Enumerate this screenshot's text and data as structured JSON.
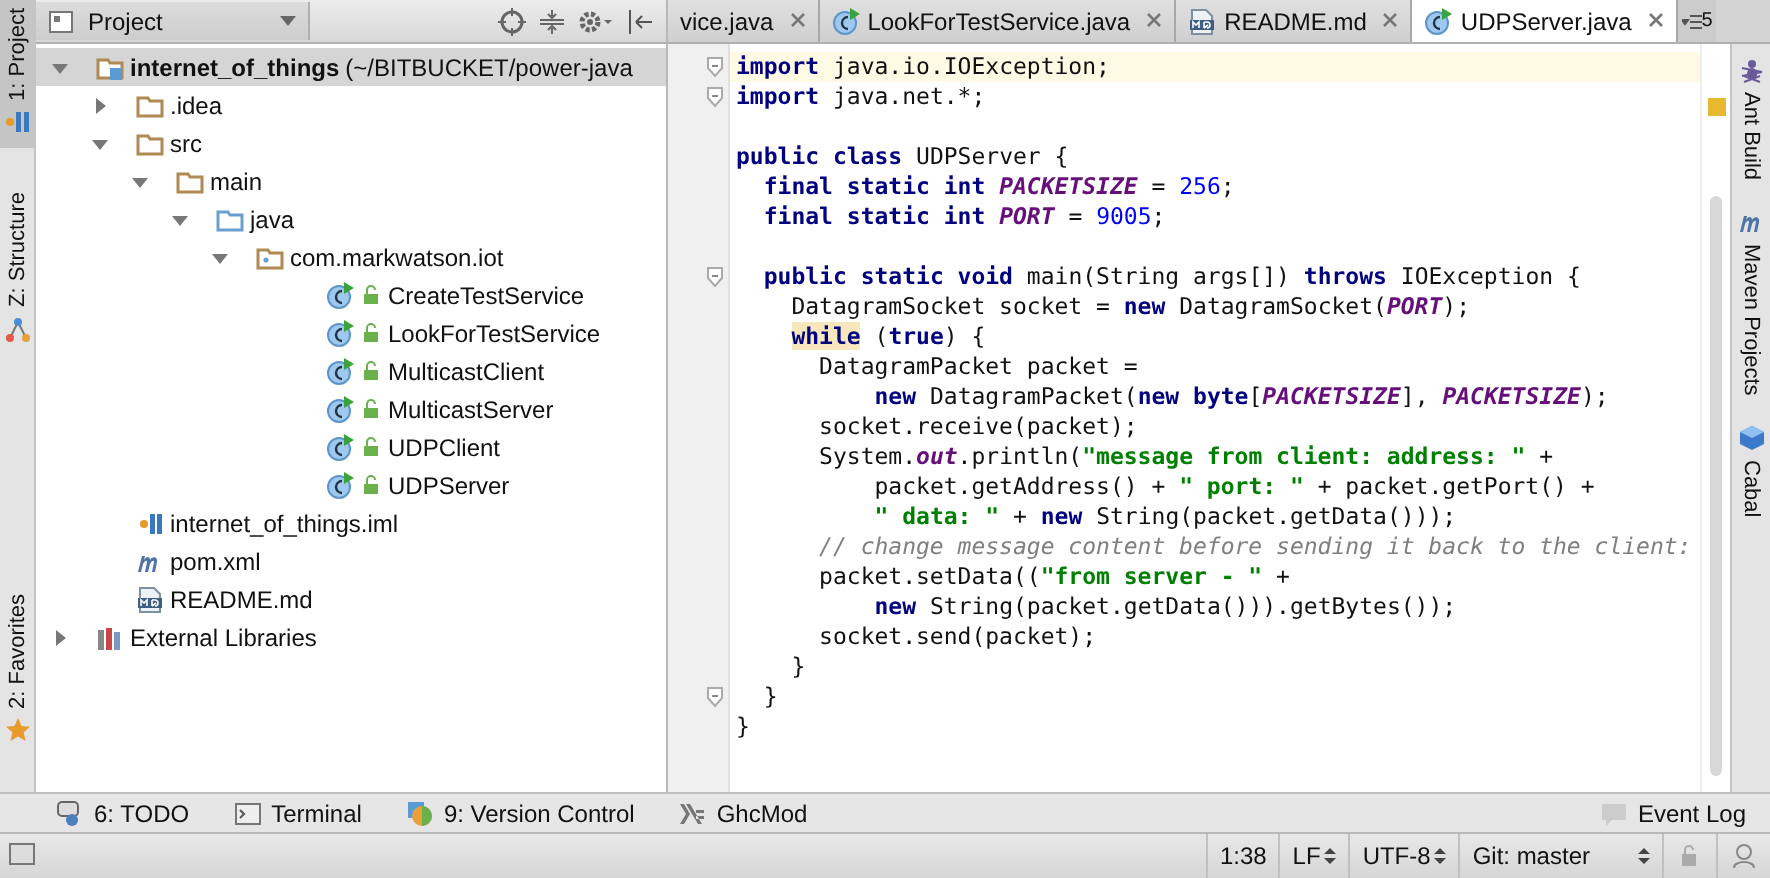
{
  "left_strip": [
    {
      "label": "1: Project",
      "kind": "project",
      "selected": true
    },
    {
      "label": "Z: Structure",
      "kind": "structure",
      "selected": false
    },
    {
      "label": "2: Favorites",
      "kind": "star",
      "selected": false
    }
  ],
  "project_panel": {
    "title": "Project"
  },
  "tree": [
    {
      "label": "internet_of_things",
      "suffix": "(~/BITBUCKET/power-java",
      "kind": "module",
      "expanded": true,
      "selected": true,
      "children": [
        {
          "label": ".idea",
          "kind": "folder",
          "expanded": false,
          "selected": false
        },
        {
          "label": "src",
          "kind": "folder",
          "expanded": true,
          "selected": false,
          "children": [
            {
              "label": "main",
              "kind": "folder",
              "expanded": true,
              "selected": false,
              "children": [
                {
                  "label": "java",
                  "kind": "source",
                  "expanded": true,
                  "selected": false,
                  "children": [
                    {
                      "label": "com.markwatson.iot",
                      "kind": "package",
                      "expanded": true,
                      "selected": false,
                      "children": [
                        {
                          "label": "CreateTestService",
                          "kind": "class",
                          "selected": false
                        },
                        {
                          "label": "LookForTestService",
                          "kind": "class",
                          "selected": false
                        },
                        {
                          "label": "MulticastClient",
                          "kind": "class",
                          "selected": false
                        },
                        {
                          "label": "MulticastServer",
                          "kind": "class",
                          "selected": false
                        },
                        {
                          "label": "UDPClient",
                          "kind": "class",
                          "selected": false
                        },
                        {
                          "label": "UDPServer",
                          "kind": "class",
                          "selected": false
                        }
                      ]
                    }
                  ]
                }
              ]
            }
          ]
        },
        {
          "label": "internet_of_things.iml",
          "kind": "iml",
          "selected": false
        },
        {
          "label": "pom.xml",
          "kind": "maven",
          "selected": false
        },
        {
          "label": "README.md",
          "kind": "md",
          "selected": false
        }
      ]
    },
    {
      "label": "External Libraries",
      "kind": "libraries",
      "expanded": false,
      "selected": false
    }
  ],
  "tabs": [
    {
      "label": "vice.java",
      "kind": "plain",
      "selected": false
    },
    {
      "label": "LookForTestService.java",
      "kind": "class",
      "selected": false
    },
    {
      "label": "README.md",
      "kind": "md",
      "selected": false
    },
    {
      "label": "UDPServer.java",
      "kind": "class",
      "selected": true
    }
  ],
  "tab_overflow": "5",
  "code_lines": [
    {
      "current": true,
      "fold": true,
      "tokens": [
        {
          "kind": "kw",
          "text": "import"
        },
        {
          "kind": "plain",
          "text": " java.io.IOException;"
        }
      ]
    },
    {
      "current": false,
      "fold": true,
      "tokens": [
        {
          "kind": "kw",
          "text": "import"
        },
        {
          "kind": "plain",
          "text": " java.net.*;"
        }
      ]
    },
    {
      "current": false,
      "fold": false
    },
    {
      "current": false,
      "fold": false,
      "tokens": [
        {
          "kind": "kw",
          "text": "public class"
        },
        {
          "kind": "plain",
          "text": " UDPServer {"
        }
      ]
    },
    {
      "current": false,
      "fold": false,
      "tokens": [
        {
          "kind": "kw",
          "text": "  final static int"
        },
        {
          "kind": "const",
          "text": " PACKETSIZE"
        },
        {
          "kind": "plain",
          "text": " = "
        },
        {
          "kind": "num",
          "text": "256"
        },
        {
          "kind": "plain",
          "text": ";"
        }
      ]
    },
    {
      "current": false,
      "fold": false,
      "tokens": [
        {
          "kind": "kw",
          "text": "  final static int"
        },
        {
          "kind": "const",
          "text": " PORT"
        },
        {
          "kind": "plain",
          "text": " = "
        },
        {
          "kind": "num",
          "text": "9005"
        },
        {
          "kind": "plain",
          "text": ";"
        }
      ]
    },
    {
      "current": false,
      "fold": false
    },
    {
      "current": false,
      "fold": true,
      "tokens": [
        {
          "kind": "kw",
          "text": "  public static void"
        },
        {
          "kind": "plain",
          "text": " main(String args[]) "
        },
        {
          "kind": "kw",
          "text": "throws"
        },
        {
          "kind": "plain",
          "text": " IOException {"
        }
      ]
    },
    {
      "current": false,
      "fold": false,
      "tokens": [
        {
          "kind": "plain",
          "text": "    DatagramSocket socket = "
        },
        {
          "kind": "kw",
          "text": "new"
        },
        {
          "kind": "plain",
          "text": " DatagramSocket("
        },
        {
          "kind": "const",
          "text": "PORT"
        },
        {
          "kind": "plain",
          "text": ");"
        }
      ]
    },
    {
      "current": false,
      "fold": false,
      "tokens": [
        {
          "kind": "kw-marked",
          "text": "    while"
        },
        {
          "kind": "plain",
          "text": " ("
        },
        {
          "kind": "kw",
          "text": "true"
        },
        {
          "kind": "plain",
          "text": ") {"
        }
      ]
    },
    {
      "current": false,
      "fold": false,
      "tokens": [
        {
          "kind": "plain",
          "text": "      DatagramPacket packet ="
        }
      ]
    },
    {
      "current": false,
      "fold": false,
      "tokens": [
        {
          "kind": "kw",
          "text": "          new"
        },
        {
          "kind": "plain",
          "text": " DatagramPacket("
        },
        {
          "kind": "kw",
          "text": "new byte"
        },
        {
          "kind": "plain",
          "text": "["
        },
        {
          "kind": "const",
          "text": "PACKETSIZE"
        },
        {
          "kind": "plain",
          "text": "], "
        },
        {
          "kind": "const",
          "text": "PACKETSIZE"
        },
        {
          "kind": "plain",
          "text": ");"
        }
      ]
    },
    {
      "current": false,
      "fold": false,
      "tokens": [
        {
          "kind": "plain",
          "text": "      socket.receive(packet);"
        }
      ]
    },
    {
      "current": false,
      "fold": false,
      "tokens": [
        {
          "kind": "plain",
          "text": "      System."
        },
        {
          "kind": "const",
          "text": "out"
        },
        {
          "kind": "plain",
          "text": ".println("
        },
        {
          "kind": "str",
          "text": "\"message from client: address: \""
        },
        {
          "kind": "plain",
          "text": " +"
        }
      ]
    },
    {
      "current": false,
      "fold": false,
      "tokens": [
        {
          "kind": "plain",
          "text": "          packet.getAddress() + "
        },
        {
          "kind": "str",
          "text": "\" port: \""
        },
        {
          "kind": "plain",
          "text": " + packet.getPort() +"
        }
      ]
    },
    {
      "current": false,
      "fold": false,
      "tokens": [
        {
          "kind": "str",
          "text": "          \" data: \""
        },
        {
          "kind": "plain",
          "text": " + "
        },
        {
          "kind": "kw",
          "text": "new"
        },
        {
          "kind": "plain",
          "text": " String(packet.getData()));"
        }
      ]
    },
    {
      "current": false,
      "fold": false,
      "tokens": [
        {
          "kind": "comment",
          "text": "      // change message content before sending it back to the client:"
        }
      ]
    },
    {
      "current": false,
      "fold": false,
      "tokens": [
        {
          "kind": "plain",
          "text": "      packet.setData(("
        },
        {
          "kind": "str",
          "text": "\"from server - \""
        },
        {
          "kind": "plain",
          "text": " +"
        }
      ]
    },
    {
      "current": false,
      "fold": false,
      "tokens": [
        {
          "kind": "kw",
          "text": "          new"
        },
        {
          "kind": "plain",
          "text": " String(packet.getData())).getBytes());"
        }
      ]
    },
    {
      "current": false,
      "fold": false,
      "tokens": [
        {
          "kind": "plain",
          "text": "      socket.send(packet);"
        }
      ]
    },
    {
      "current": false,
      "fold": false,
      "tokens": [
        {
          "kind": "plain",
          "text": "    }"
        }
      ]
    },
    {
      "current": false,
      "fold": true,
      "tokens": [
        {
          "kind": "plain",
          "text": "  }"
        }
      ]
    },
    {
      "current": false,
      "fold": false,
      "tokens": [
        {
          "kind": "plain",
          "text": "}"
        }
      ]
    }
  ],
  "right_strip": [
    {
      "label": "Ant Build",
      "kind": "ant"
    },
    {
      "label": "Maven Projects",
      "kind": "maven"
    },
    {
      "label": "Cabal",
      "kind": "cabal"
    }
  ],
  "tool_buttons": [
    {
      "label": "6: TODO",
      "kind": "todo"
    },
    {
      "label": "Terminal",
      "kind": "terminal"
    },
    {
      "label": "9: Version Control",
      "kind": "vcs"
    },
    {
      "label": "GhcMod",
      "kind": "ghcmod"
    }
  ],
  "event_log": "Event Log",
  "status_bar": {
    "position": "1:38",
    "line_separator": "LF",
    "encoding": "UTF-8",
    "branch": "Git: master"
  }
}
